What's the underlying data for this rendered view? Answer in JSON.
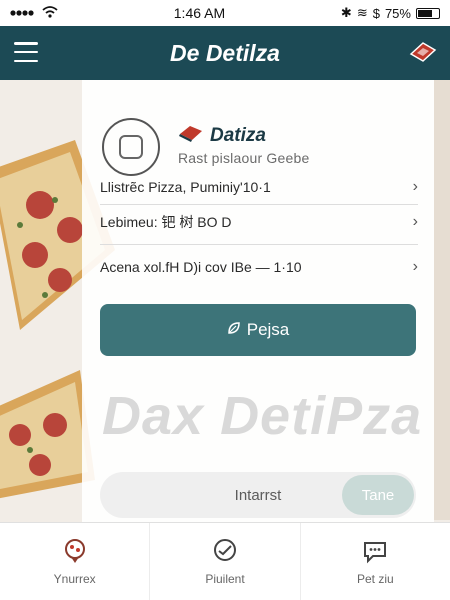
{
  "status": {
    "time": "1:46 AM",
    "battery": "75%",
    "battery_level": 0.75
  },
  "nav": {
    "title": "De Detilza"
  },
  "card": {
    "brand_name": "Datiza",
    "brand_subtitle": "Rast pislaour Geebe",
    "rows": [
      {
        "label": "Llistrẽc Pizza, Puminiy'10·1"
      },
      {
        "label": "Lebimeu: 钯 树  BO D"
      },
      {
        "label": "Acena xol.fH D)i cov IBe — 1·10"
      }
    ],
    "primary_button": "Pejsa",
    "watermark": "Dax DetiPza",
    "search_placeholder": "Intarrst",
    "search_button": "Tane"
  },
  "tabs": [
    {
      "label": "Ynurrex"
    },
    {
      "label": "Piuilent"
    },
    {
      "label": "Pet ziu"
    }
  ],
  "colors": {
    "brand": "#1c4a55",
    "accent": "#3d7479",
    "logo_red": "#c0392b"
  }
}
